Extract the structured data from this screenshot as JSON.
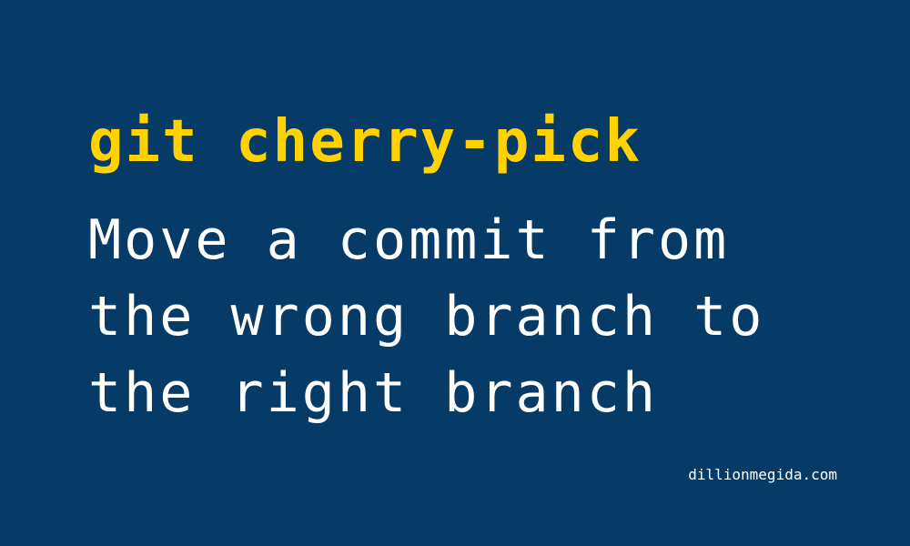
{
  "banner": {
    "title": "git cherry-pick",
    "subtitle_lines": [
      "Move a commit from",
      "the wrong branch to",
      "the right branch"
    ],
    "website": "dillionmegida.com"
  },
  "colors": {
    "background": "#063b68",
    "title": "#ffd200",
    "text": "#ffffff"
  }
}
